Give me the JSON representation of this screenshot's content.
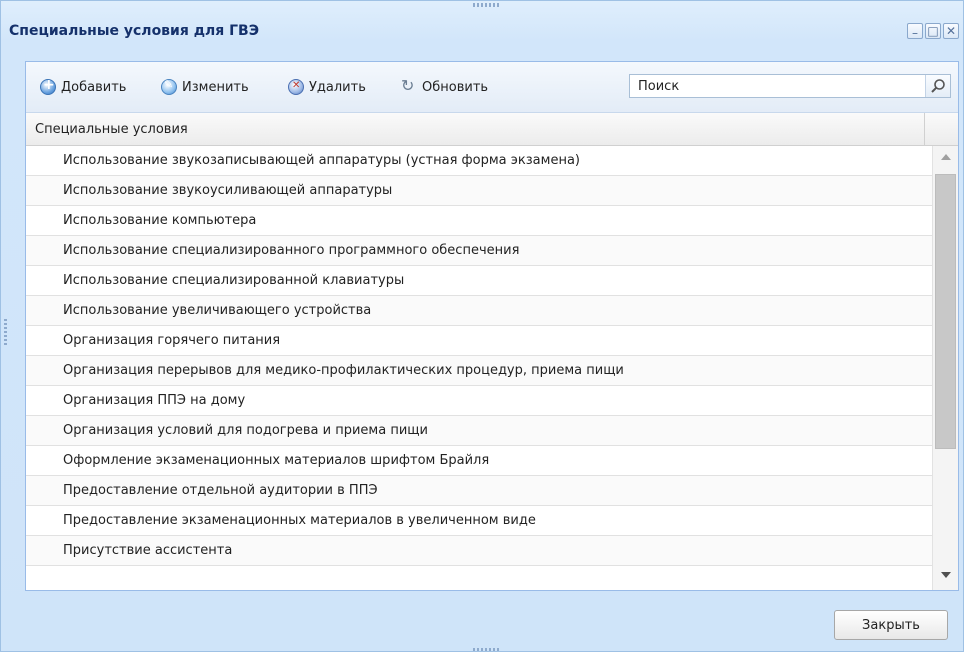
{
  "window": {
    "title": "Специальные условия для ГВЭ",
    "controls": [
      "minimize-icon",
      "maximize-icon",
      "close-icon"
    ]
  },
  "toolbar": {
    "add_label": "Добавить",
    "edit_label": "Изменить",
    "delete_label": "Удалить",
    "refresh_label": "Обновить",
    "search_placeholder": "Поиск"
  },
  "grid": {
    "column_header": "Специальные условия",
    "rows": [
      "Использование звукозаписывающей аппаратуры (устная форма экзамена)",
      "Использование звукоусиливающей аппаратуры",
      "Использование компьютера",
      "Использование специализированного программного обеспечения",
      "Использование специализированной клавиатуры",
      "Использование увеличивающего устройства",
      "Организация горячего питания",
      "Организация перерывов для медико-профилактических процедур, приема пищи",
      "Организация ППЭ на дому",
      "Организация условий для подогрева и приема пищи",
      "Оформление экзаменационных материалов шрифтом Брайля",
      "Предоставление отдельной аудитории в ППЭ",
      "Предоставление экзаменационных материалов в увеличенном виде",
      "Присутствие ассистента"
    ]
  },
  "footer": {
    "close_label": "Закрыть"
  },
  "colors": {
    "window_bg": "#d2e6fa",
    "title_text": "#15316b",
    "border": "#99bbe8"
  }
}
